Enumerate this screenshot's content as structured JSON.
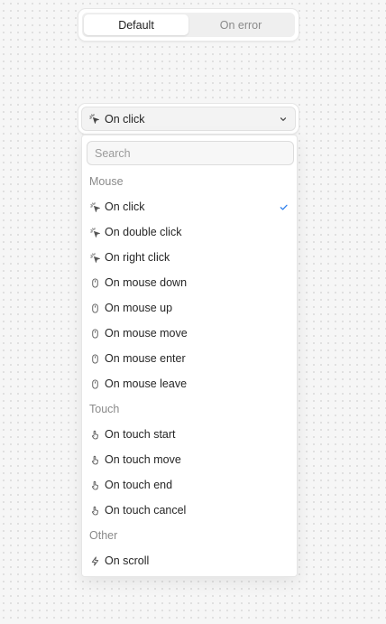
{
  "segmented": {
    "default_label": "Default",
    "error_label": "On error"
  },
  "trigger": {
    "label": "On click"
  },
  "search": {
    "placeholder": "Search"
  },
  "groups": {
    "mouse": "Mouse",
    "touch": "Touch",
    "other": "Other"
  },
  "items": {
    "click": "On click",
    "double_click": "On double click",
    "right_click": "On right click",
    "mouse_down": "On mouse down",
    "mouse_up": "On mouse up",
    "mouse_move": "On mouse move",
    "mouse_enter": "On mouse enter",
    "mouse_leave": "On mouse leave",
    "touch_start": "On touch start",
    "touch_move": "On touch move",
    "touch_end": "On touch end",
    "touch_cancel": "On touch cancel",
    "scroll": "On scroll"
  },
  "colors": {
    "accent": "#2f80ed"
  }
}
